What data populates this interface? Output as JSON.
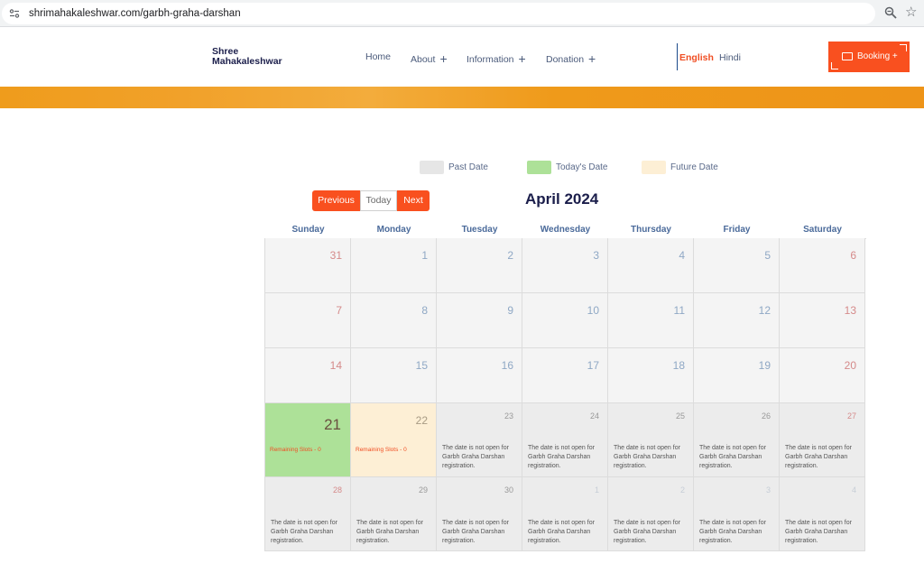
{
  "browser": {
    "url": "shrimahakaleshwar.com/garbh-graha-darshan"
  },
  "header": {
    "logo_line1": "Shree",
    "logo_line2": "Mahakaleshwar",
    "nav": [
      "Home",
      "About",
      "Information",
      "Donation"
    ],
    "lang_english": "English",
    "lang_hindi": "Hindi",
    "booking_label": "Booking +",
    "accent_color": "#f9501f",
    "banner_color": "#ef9c1c"
  },
  "legend": {
    "past": "Past Date",
    "today": "Today's Date",
    "future": "Future Date"
  },
  "controls": {
    "previous": "Previous",
    "today": "Today",
    "next": "Next"
  },
  "calendar": {
    "month_title": "April 2024",
    "weekdays": [
      "Sunday",
      "Monday",
      "Tuesday",
      "Wednesday",
      "Thursday",
      "Friday",
      "Saturday"
    ],
    "remaining_slots_label": "Remaining Slots - 0",
    "closed_note": "The date is not open for Garbh Graha Darshan registration.",
    "weeks": [
      [
        "31",
        "1",
        "2",
        "3",
        "4",
        "5",
        "6"
      ],
      [
        "7",
        "8",
        "9",
        "10",
        "11",
        "12",
        "13"
      ],
      [
        "14",
        "15",
        "16",
        "17",
        "18",
        "19",
        "20"
      ],
      [
        "21",
        "22",
        "23",
        "24",
        "25",
        "26",
        "27"
      ],
      [
        "28",
        "29",
        "30",
        "1",
        "2",
        "3",
        "4"
      ]
    ]
  }
}
